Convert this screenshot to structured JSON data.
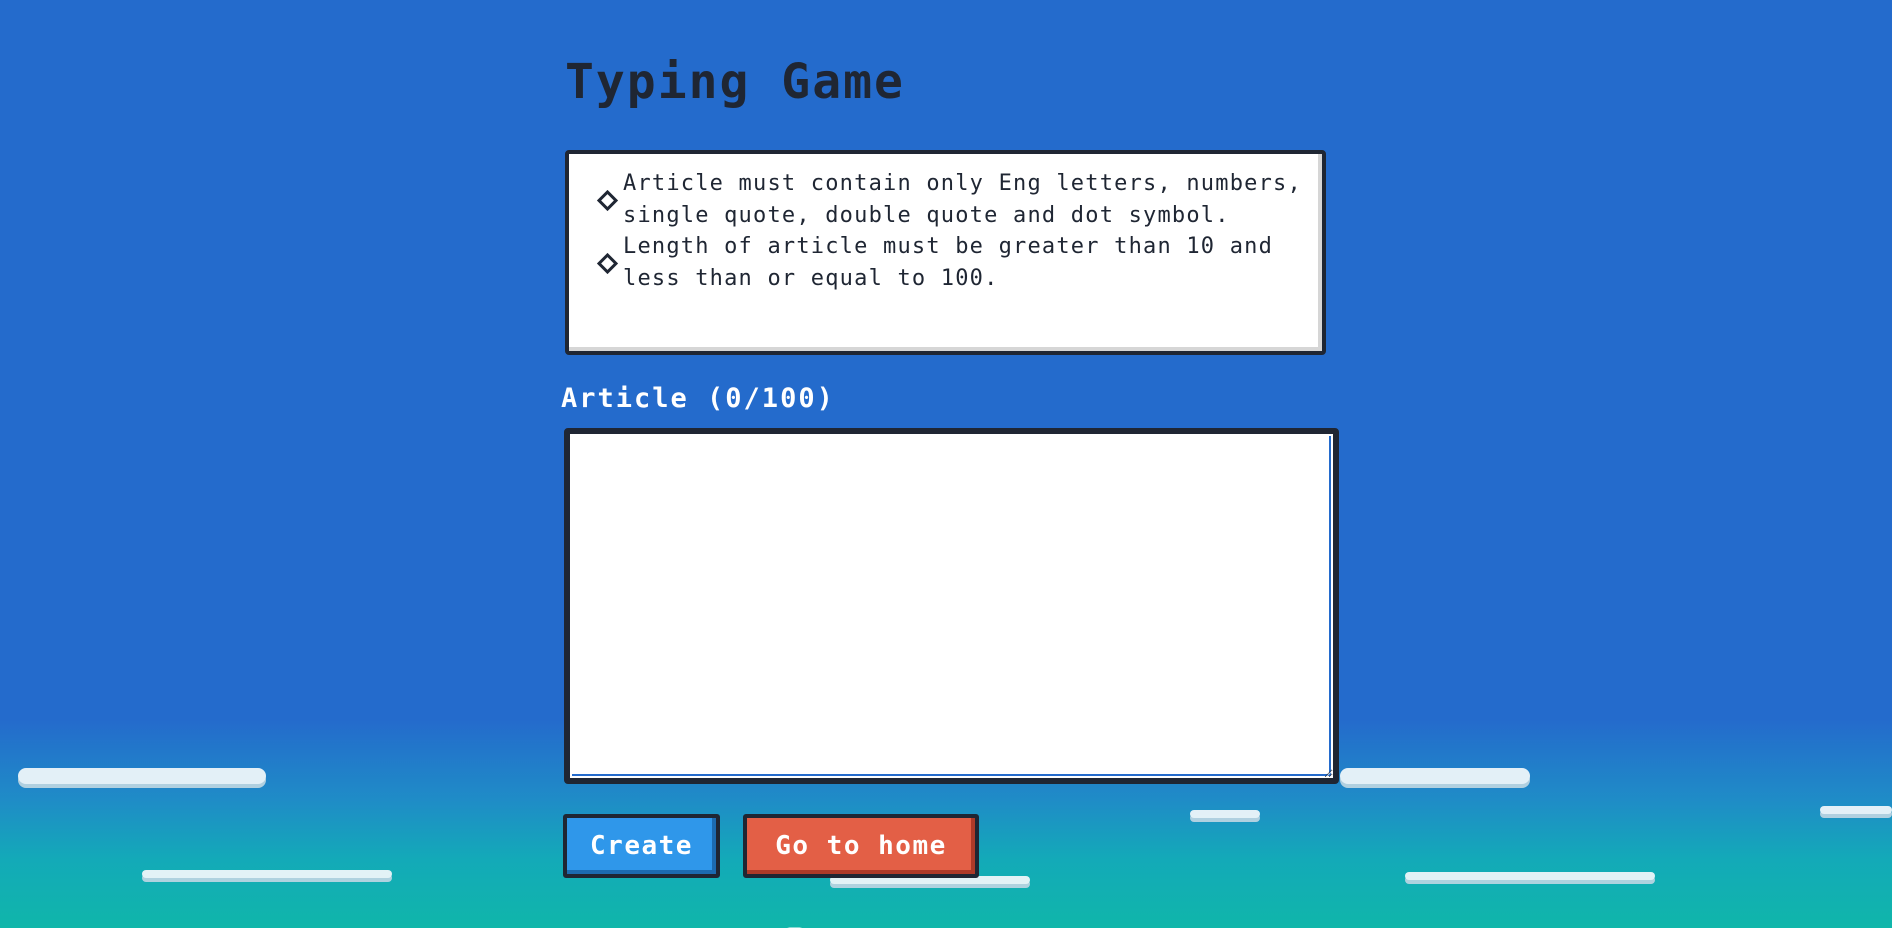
{
  "page": {
    "title": "Typing Game"
  },
  "rules": [
    "Article must contain only Eng letters, numbers, single quote, double quote and dot symbol.",
    "Length of article must be greater than 10 and less than or equal to 100."
  ],
  "article": {
    "label": "Article (0/100)",
    "value": "",
    "placeholder": ""
  },
  "buttons": {
    "create_label": "Create",
    "home_label": "Go to home"
  },
  "colors": {
    "background_sky": "#246bcc",
    "background_bottom": "#10b6aa",
    "text_dark": "#1f2633",
    "create_button": "#2f97ea",
    "home_button": "#e35f46"
  }
}
